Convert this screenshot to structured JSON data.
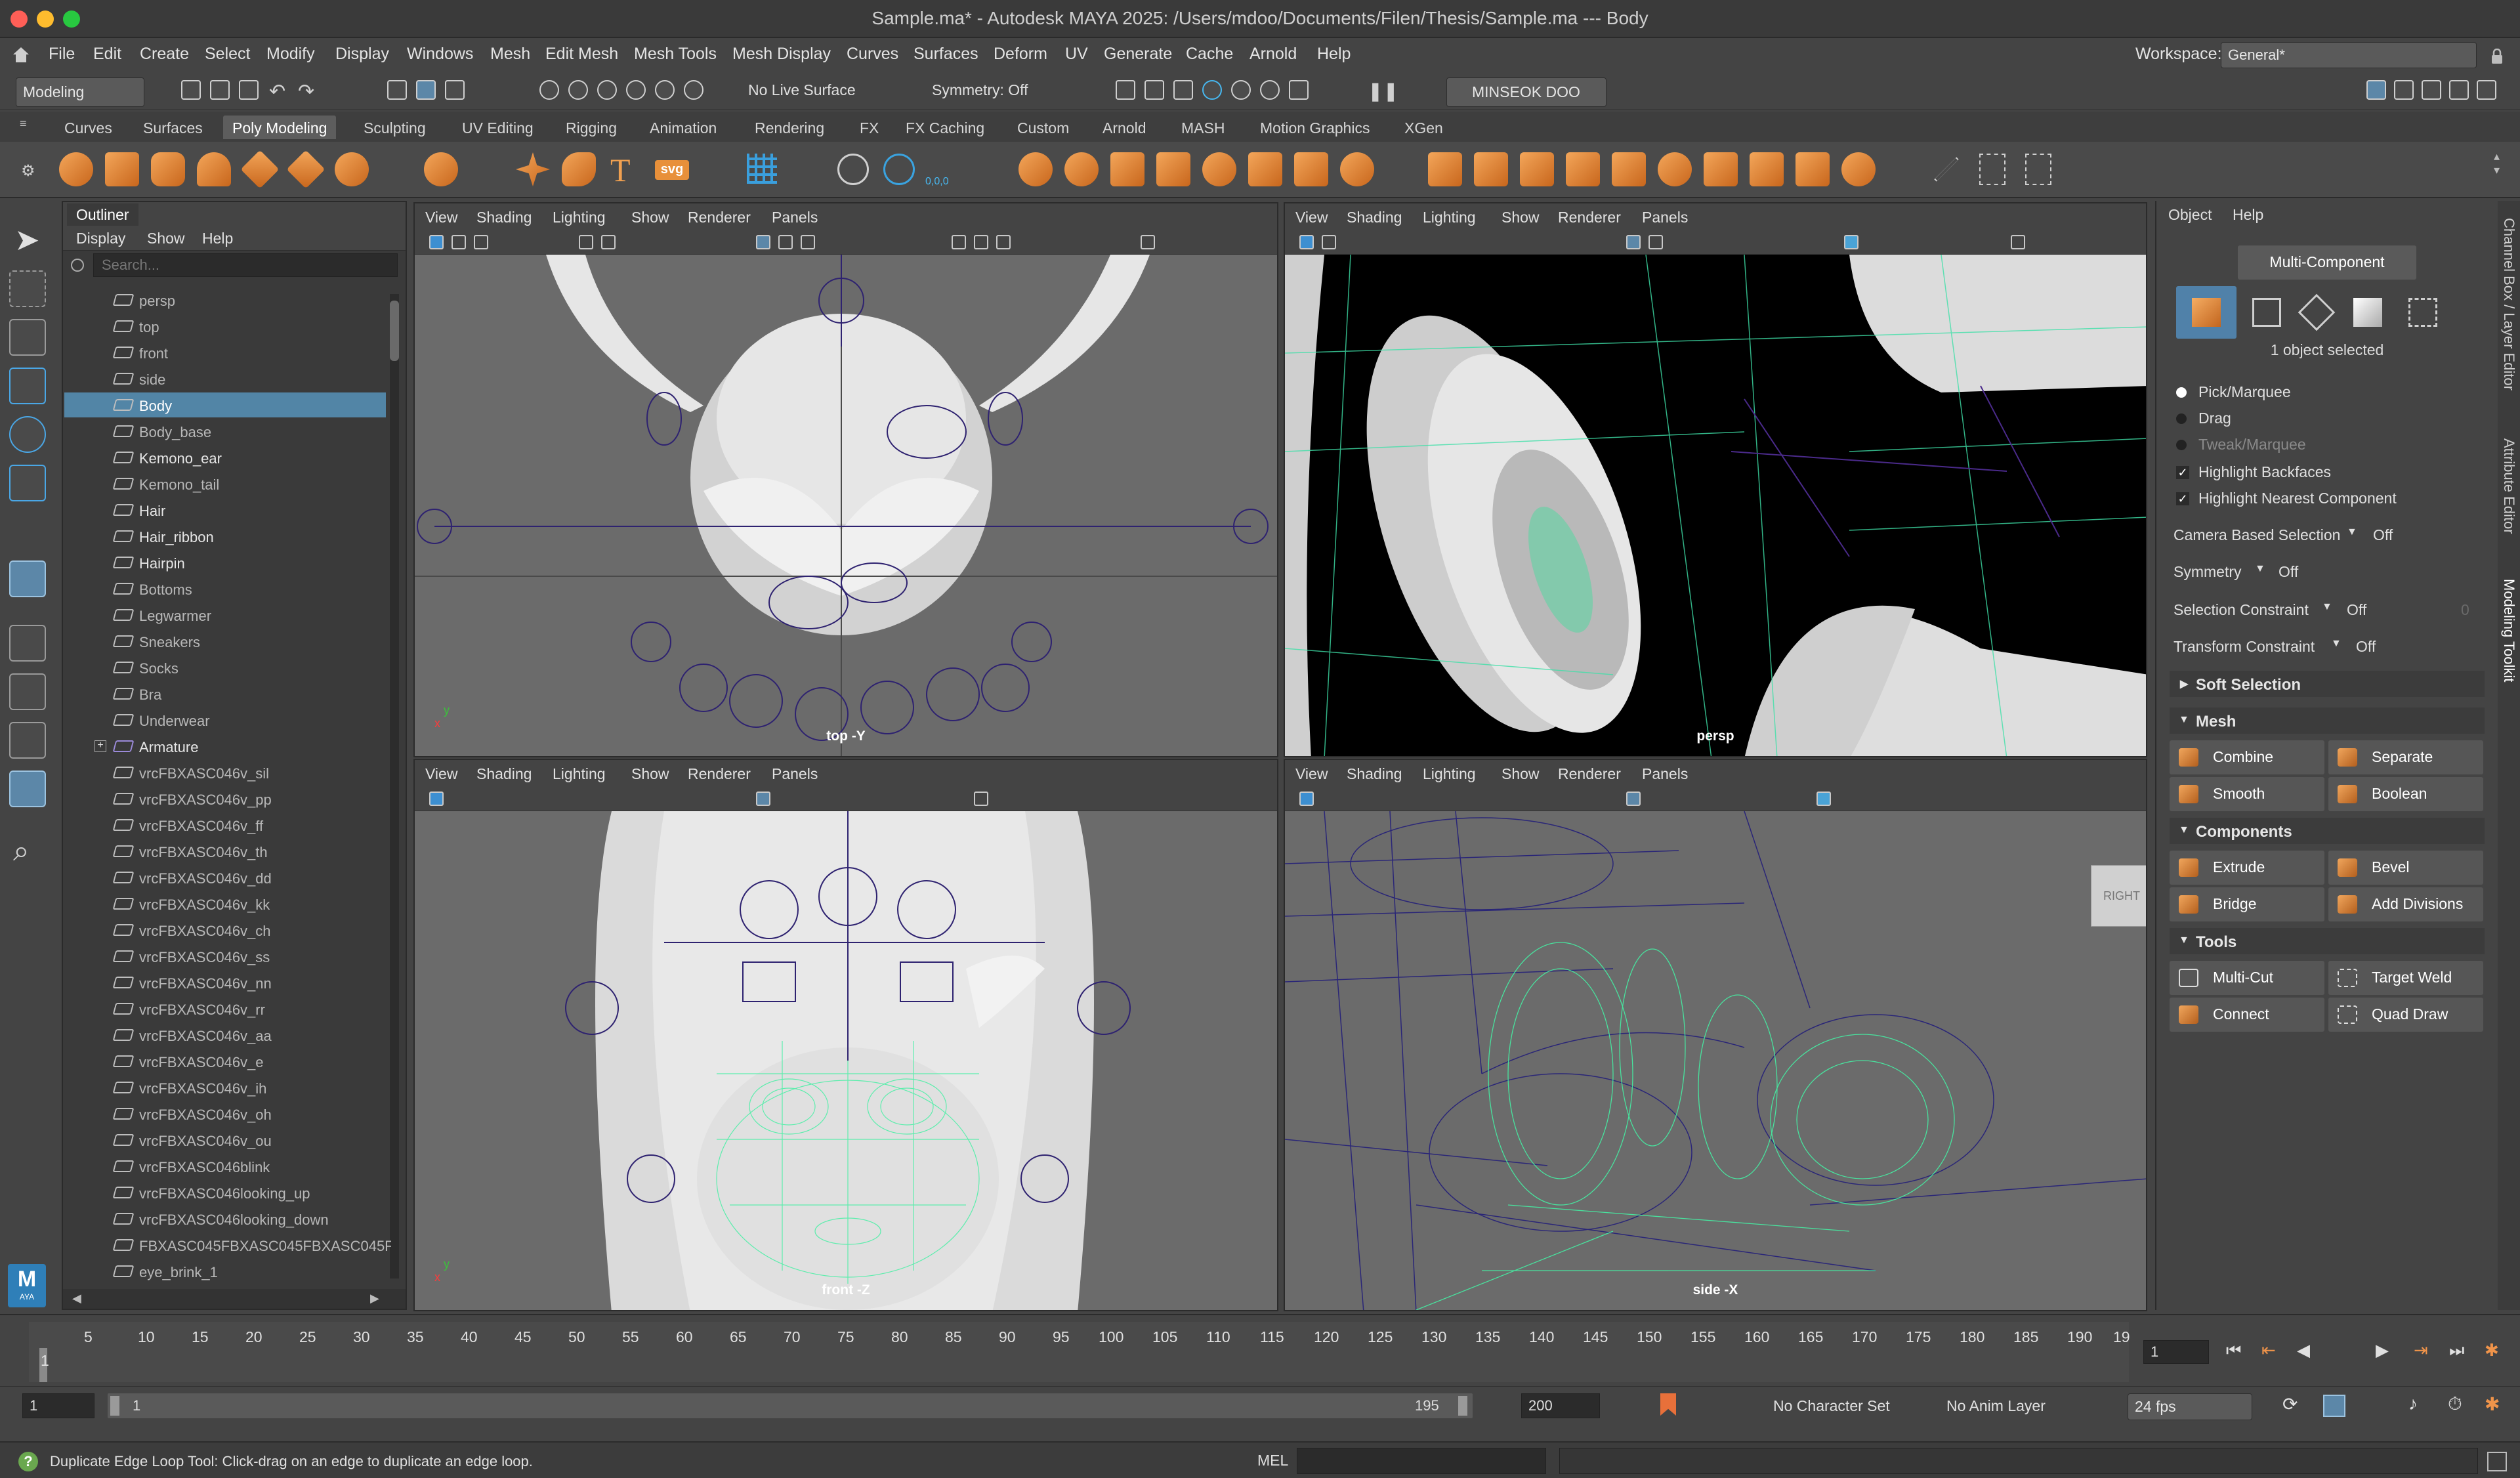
{
  "window": {
    "title": "Sample.ma* - Autodesk MAYA 2025: /Users/mdoo/Documents/Filen/Thesis/Sample.ma   ---   Body"
  },
  "menus": [
    "File",
    "Edit",
    "Create",
    "Select",
    "Modify",
    "Display",
    "Windows",
    "Mesh",
    "Edit Mesh",
    "Mesh Tools",
    "Mesh Display",
    "Curves",
    "Surfaces",
    "Deform",
    "UV",
    "Generate",
    "Cache",
    "Arnold",
    "Help"
  ],
  "workspace": {
    "label": "Workspace:",
    "value": "General*"
  },
  "statusline": {
    "mode": "Modeling",
    "live_surface": "No Live Surface",
    "symmetry": "Symmetry: Off",
    "user": "MINSEOK DOO"
  },
  "shelf_tabs": [
    "Curves",
    "Surfaces",
    "Poly Modeling",
    "Sculpting",
    "UV Editing",
    "Rigging",
    "Animation",
    "Rendering",
    "FX",
    "FX Caching",
    "Custom",
    "Arnold",
    "MASH",
    "Motion Graphics",
    "XGen"
  ],
  "shelf_text_labels": {
    "svg": "svg",
    "coord": "0,0,0"
  },
  "outliner": {
    "title": "Outliner",
    "menus": [
      "Display",
      "Show",
      "Help"
    ],
    "search_placeholder": "Search...",
    "items": [
      "persp",
      "top",
      "front",
      "side",
      "Body",
      "Body_base",
      "Kemono_ear",
      "Kemono_tail",
      "Hair",
      "Hair_ribbon",
      "Hairpin",
      "Bottoms",
      "Legwarmer",
      "Sneakers",
      "Socks",
      "Bra",
      "Underwear",
      "Armature",
      "vrcFBXASC046v_sil",
      "vrcFBXASC046v_pp",
      "vrcFBXASC046v_ff",
      "vrcFBXASC046v_th",
      "vrcFBXASC046v_dd",
      "vrcFBXASC046v_kk",
      "vrcFBXASC046v_ch",
      "vrcFBXASC046v_ss",
      "vrcFBXASC046v_nn",
      "vrcFBXASC046v_rr",
      "vrcFBXASC046v_aa",
      "vrcFBXASC046v_e",
      "vrcFBXASC046v_ih",
      "vrcFBXASC046v_oh",
      "vrcFBXASC046v_ou",
      "vrcFBXASC046blink",
      "vrcFBXASC046looking_up",
      "vrcFBXASC046looking_down",
      "FBXASC045FBXASC045FBXASC045F",
      "eye_brink_1"
    ]
  },
  "viewport_menu": [
    "View",
    "Shading",
    "Lighting",
    "Show",
    "Renderer",
    "Panels"
  ],
  "viewports": {
    "top": "top -Y",
    "persp": "persp",
    "front": "front -Z",
    "side": "side -X",
    "cube": "RIGHT"
  },
  "toolkit": {
    "tabs": [
      "Object",
      "Help"
    ],
    "mode_button": "Multi-Component",
    "selected_text": "1 object selected",
    "pick": "Pick/Marquee",
    "drag": "Drag",
    "tweak": "Tweak/Marquee",
    "highlight_backfaces": "Highlight Backfaces",
    "highlight_nearest": "Highlight Nearest Component",
    "camera_based_selection": "Camera Based Selection",
    "camera_based_value": "Off",
    "symmetry": "Symmetry",
    "symmetry_value": "Off",
    "selection_constraint": "Selection Constraint",
    "selection_constraint_value": "Off",
    "selection_constraint_num": "0",
    "transform_constraint": "Transform Constraint",
    "transform_constraint_value": "Off",
    "soft_selection": "Soft Selection",
    "mesh": "Mesh",
    "components": "Components",
    "tools": "Tools",
    "buttons": {
      "combine": "Combine",
      "separate": "Separate",
      "smooth": "Smooth",
      "boolean": "Boolean",
      "extrude": "Extrude",
      "bevel": "Bevel",
      "bridge": "Bridge",
      "add_divisions": "Add Divisions",
      "multi_cut": "Multi-Cut",
      "target_weld": "Target Weld",
      "connect": "Connect",
      "quad_draw": "Quad Draw"
    }
  },
  "side_tabs": [
    "Channel Box / Layer Editor",
    "Attribute Editor",
    "Modeling Toolkit"
  ],
  "timeline": {
    "ticks": [
      "5",
      "10",
      "15",
      "20",
      "25",
      "30",
      "35",
      "40",
      "45",
      "50",
      "55",
      "60",
      "65",
      "70",
      "75",
      "80",
      "85",
      "90",
      "95",
      "100",
      "105",
      "110",
      "115",
      "120",
      "125",
      "130",
      "135",
      "140",
      "145",
      "150",
      "155",
      "160",
      "165",
      "170",
      "175",
      "180",
      "185",
      "190",
      "19"
    ],
    "start_marker": "1",
    "current_frame": "1"
  },
  "range": {
    "start": "1",
    "range_start": "1",
    "range_end": "195",
    "end": "200",
    "character_set": "No Character Set",
    "anim_layer": "No Anim Layer",
    "fps": "24 fps"
  },
  "helpline": {
    "text": "Duplicate Edge Loop Tool: Click-drag on an edge to duplicate an edge loop.",
    "mel": "MEL"
  },
  "logo": {
    "letter": "M",
    "sub": "AYA"
  },
  "colors": {
    "accent": "#5285a6",
    "shelf_orange": "#e38a3a",
    "wire_green": "#4dffb0",
    "wire_blue": "#25207a"
  }
}
